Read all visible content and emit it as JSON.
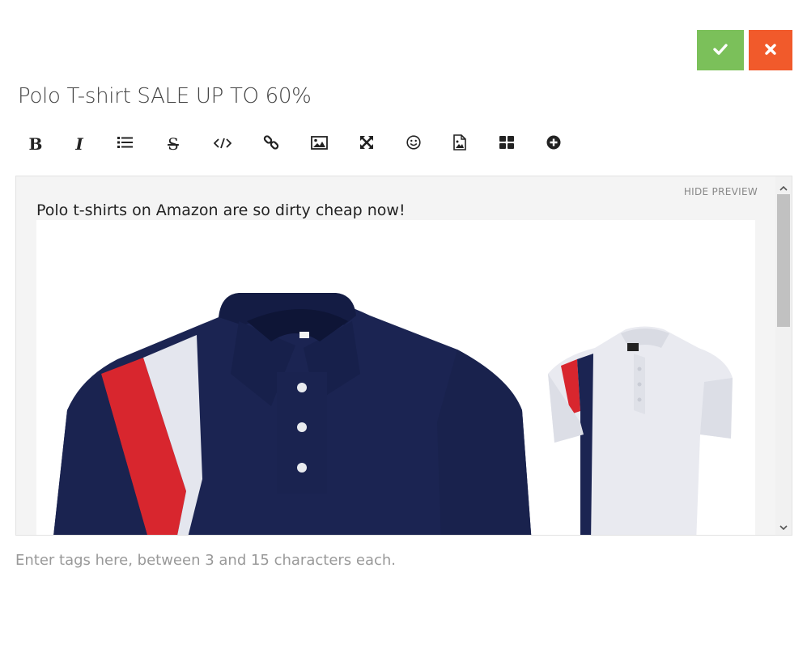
{
  "actions": {
    "confirm_icon": "check-icon",
    "cancel_icon": "close-icon",
    "confirm_color": "#7bc05a",
    "cancel_color": "#f15a2b"
  },
  "post": {
    "title": "Polo T-shirt SALE UP TO 60%"
  },
  "toolbar": {
    "items": [
      {
        "name": "bold",
        "glyph": "B"
      },
      {
        "name": "italic",
        "glyph": "I"
      },
      {
        "name": "bullet-list"
      },
      {
        "name": "strikethrough",
        "glyph": "S"
      },
      {
        "name": "code"
      },
      {
        "name": "link"
      },
      {
        "name": "image"
      },
      {
        "name": "fullscreen"
      },
      {
        "name": "emoji"
      },
      {
        "name": "file-image"
      },
      {
        "name": "gallery"
      },
      {
        "name": "add-more"
      }
    ]
  },
  "editor": {
    "hide_preview_label": "HIDE PREVIEW",
    "preview_text": "Polo t-shirts on Amazon are so dirty cheap now!",
    "image_alt": "Navy polo t-shirt with red and white stripes, and a white polo t-shirt"
  },
  "tags": {
    "placeholder": "Enter tags here, between 3 and 15 characters each."
  }
}
